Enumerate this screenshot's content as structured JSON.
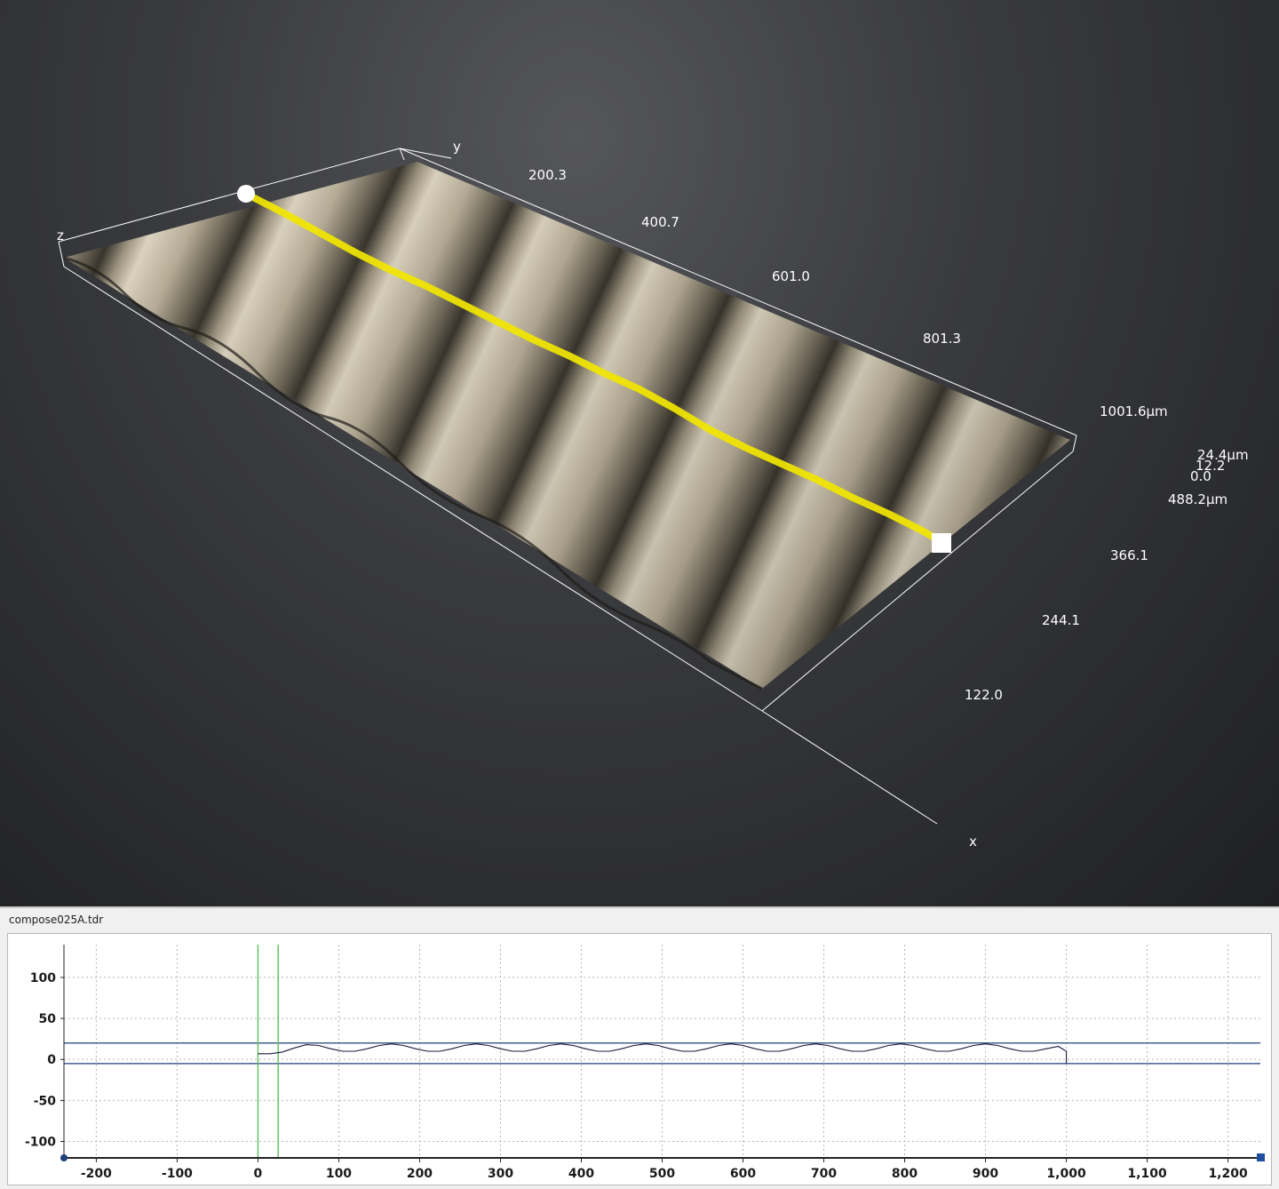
{
  "viewport": {
    "axes": {
      "x": "x",
      "y": "y",
      "z": "z"
    },
    "y_ticks": [
      "200.3",
      "400.7",
      "601.0",
      "801.3",
      "1001.6μm"
    ],
    "x_ticks": [
      "488.2μm",
      "366.1",
      "244.1",
      "122.0"
    ],
    "z_ticks": [
      "24.4μm",
      "12.2",
      "0.0"
    ],
    "colors": {
      "profile_line": "#f2e600",
      "surface": "#b5ab96",
      "background": "#2a2b2e"
    },
    "markers": {
      "start": "circle-marker",
      "end": "square-marker"
    }
  },
  "panel": {
    "title": "compose025A.tdr"
  },
  "chart_data": {
    "type": "line",
    "xlim": [
      -240,
      1240
    ],
    "ylim": [
      -120,
      140
    ],
    "x_ticks": [
      -200,
      -100,
      0,
      100,
      200,
      300,
      400,
      500,
      600,
      700,
      800,
      900,
      1000,
      1100,
      1200
    ],
    "x_tick_labels": [
      "-200",
      "-100",
      "0",
      "100",
      "200",
      "300",
      "400",
      "500",
      "600",
      "700",
      "800",
      "900",
      "1,000",
      "1,100",
      "1,200"
    ],
    "y_ticks": [
      -100,
      -50,
      0,
      50,
      100
    ],
    "y_tick_labels": [
      "-100",
      "-50",
      "0",
      "50",
      "100"
    ],
    "grid": true,
    "h_lines": [
      20,
      -5
    ],
    "v_lines": [
      0,
      25
    ],
    "series": [
      {
        "x": [
          0,
          15,
          30,
          45,
          60,
          75,
          90,
          105,
          120,
          135,
          150,
          165,
          180,
          195,
          210,
          225,
          240,
          255,
          270,
          285,
          300,
          315,
          330,
          345,
          360,
          375,
          390,
          405,
          420,
          435,
          450,
          465,
          480,
          495,
          510,
          525,
          540,
          555,
          570,
          585,
          600,
          615,
          630,
          645,
          660,
          675,
          690,
          705,
          720,
          735,
          750,
          765,
          780,
          795,
          810,
          825,
          840,
          855,
          870,
          885,
          900,
          915,
          930,
          945,
          960,
          975,
          990,
          1000,
          1000
        ],
        "y": [
          7,
          7,
          9,
          14,
          18,
          17,
          13,
          10,
          10,
          13,
          17,
          19,
          17,
          13,
          10,
          10,
          13,
          17,
          19,
          17,
          13,
          10,
          10,
          13,
          17,
          19,
          17,
          13,
          10,
          10,
          13,
          17,
          19,
          17,
          13,
          10,
          10,
          13,
          17,
          19,
          17,
          13,
          10,
          10,
          13,
          17,
          19,
          17,
          13,
          10,
          10,
          13,
          17,
          19,
          17,
          13,
          10,
          10,
          13,
          17,
          19,
          17,
          13,
          10,
          10,
          13,
          16,
          10,
          -5
        ]
      }
    ]
  }
}
